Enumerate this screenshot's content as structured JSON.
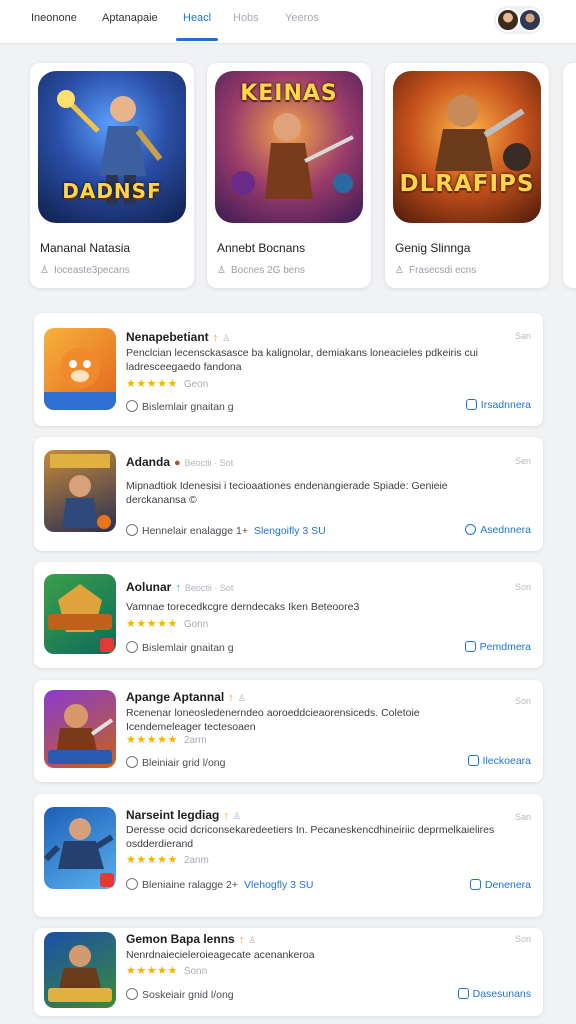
{
  "nav": {
    "tabs": [
      "Ineonone",
      "Aptanapaie",
      "Heacl",
      "Hobs",
      "Yeeros"
    ],
    "active_index": 2
  },
  "featured": [
    {
      "art_title": "DADNSF",
      "name": "Mananal Natasia",
      "meta": "Ioceaste3pecans",
      "colors": [
        "#1c3f88",
        "#3a63c4"
      ]
    },
    {
      "art_title": "KEINAS",
      "name": "Annebt Bocnans",
      "meta": "Bocnes 2G bens",
      "colors": [
        "#5c2b7a",
        "#d8792c"
      ]
    },
    {
      "art_title": "DLRAFIPS",
      "name": "Genig Slinnga",
      "meta": "Frasecsdi ecns",
      "colors": [
        "#8a3a10",
        "#e38a1c"
      ]
    }
  ],
  "list": [
    {
      "title": "Nenapebetiant",
      "badge": "↑",
      "sub": "",
      "time": "San",
      "desc": "Penclcian lecensckasasce ba kalignolar, demiakans loneacieles pdkeiris cui ladresceegaedo fandona",
      "stars": "★★★★★",
      "rating": "Geon",
      "foot": "Bislemlair gnaitan g",
      "link": "",
      "action": "Irsadnnera",
      "colors": [
        "#f08a1c",
        "#2e6fd0"
      ]
    },
    {
      "title": "Adanda",
      "badge": "●",
      "sub": "Beoctii · Sot",
      "time": "Sen",
      "desc": "Mipnadtiok Idenesisi i tecioaationes endenangierade Spiade: Genieie derckanansa ©",
      "stars": "",
      "rating": "",
      "foot": "Hennelair enalagge 1+",
      "link": "Slengoifly 3 SU",
      "action": "Asednnera",
      "colors": [
        "#5a3a1c",
        "#1f3f7a"
      ]
    },
    {
      "title": "Aolunar",
      "badge": "↑",
      "sub": "Beoctii · Sot",
      "time": "Son",
      "desc": "Vamnae torecedkcgre derndecaks Iken Beteoore3",
      "stars": "★★★★★",
      "rating": "Gonn",
      "foot": "Bislemlair gnaitan g",
      "link": "",
      "action": "Pemdmera",
      "colors": [
        "#1f6d3a",
        "#0e7a64"
      ]
    },
    {
      "title": "Apange Aptannal",
      "badge": "↑",
      "sub": "",
      "time": "Son",
      "desc": "Rcenenar loneosledenerndeo aoroeddcieaorensiceds. Coletoie Icendemeleager tectesoaen",
      "stars": "★★★★★",
      "rating": "2arm",
      "foot": "Bleiniair grid l/ong",
      "link": "",
      "action": "Ileckoeara",
      "colors": [
        "#7a2da2",
        "#c46a1c"
      ]
    },
    {
      "title": "Narseint legdiag",
      "badge": "↑",
      "sub": "",
      "time": "San",
      "desc": "Deresse ocid dcriconsekaredeetiers In. Pecaneskencdhineiriic deprmelkaielires osdderdierand",
      "stars": "★★★★★",
      "rating": "2anm",
      "foot": "Bleniaine ralagge 2+",
      "link": "Vlehogfly 3 SU",
      "action": "Denenera",
      "colors": [
        "#1d5fb8",
        "#4aa0e6"
      ]
    },
    {
      "title": "Gemon Bapa lenns",
      "badge": "↑",
      "sub": "",
      "time": "Son",
      "desc": "Nenrdnaiecieleroieagecate acenankeroa",
      "stars": "★★★★★",
      "rating": "Sonn",
      "foot": "Soskeiair gnid l/ong",
      "link": "",
      "action": "Dasesunans",
      "colors": [
        "#1b4fa8",
        "#2f8a3a"
      ]
    }
  ]
}
